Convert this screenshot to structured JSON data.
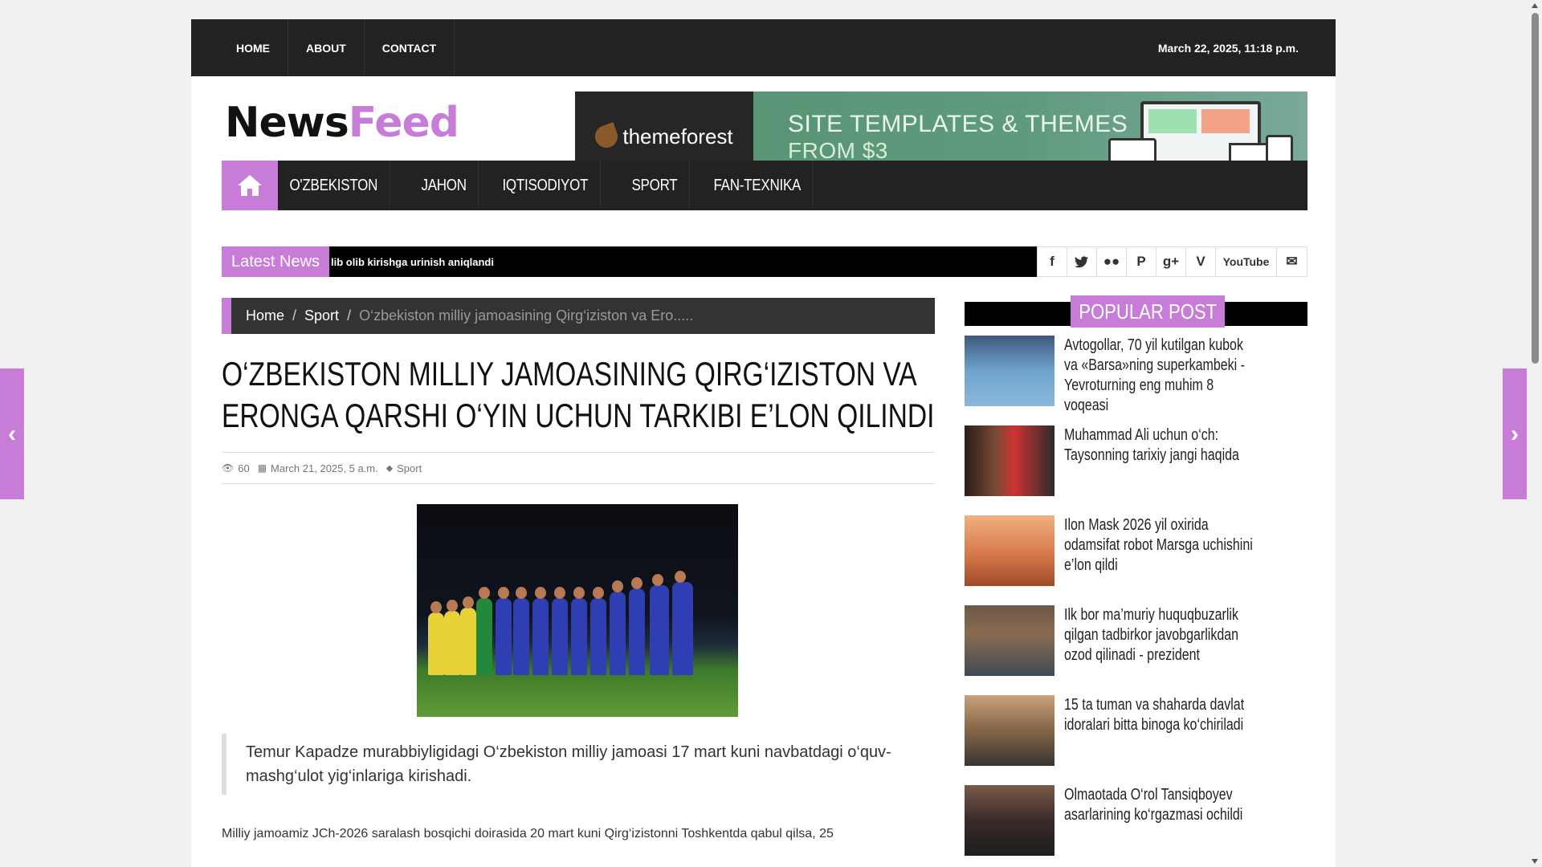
{
  "topbar": {
    "nav": [
      "HOME",
      "ABOUT",
      "CONTACT"
    ],
    "datetime": "March 22, 2025, 11:18 p.m."
  },
  "logo": {
    "part1": "News",
    "part2": "Feed"
  },
  "banner": {
    "brand": "themeforest",
    "line1": "SITE TEMPLATES & THEMES",
    "line2": "FROM $3"
  },
  "mainnav": {
    "home_icon": "home-icon",
    "items": [
      "O'ZBEKISTON",
      "JAHON",
      "IQTISODIYOT",
      "SPORT",
      "FAN-TEXNIKA"
    ]
  },
  "ticker": {
    "label": "Latest News",
    "text": "lib olib kirishga urinish aniqlandi"
  },
  "social": {
    "icons": [
      "facebook-icon",
      "twitter-icon",
      "flickr-icon",
      "pinterest-icon",
      "google-plus-icon",
      "vimeo-icon",
      "youtube-icon",
      "mail-icon"
    ],
    "youtube_text": "YouTube"
  },
  "breadcrumb": {
    "home": "Home",
    "section": "Sport",
    "current": "O‘zbekiston milliy jamoasining Qirg‘iziston va Ero....."
  },
  "article": {
    "title": "O‘ZBEKISTON MILLIY JAMOASINING QIRG‘IZISTON VA ERONGA QARSHI O‘YIN UCHUN TARKIBI E’LON QILINDI",
    "views": "60",
    "date": "March 21, 2025, 5 a.m.",
    "category": "Sport",
    "quote": "Temur Kapadze murabbiyligidagi O‘zbekiston milliy jamoasi 17 mart kuni navbatdagi o‘quv-mashg‘ulot yig‘inlariga kirishadi.",
    "paragraph": "Milliy jamoamiz JCh-2026 saralash bosqichi doirasida 20 mart kuni Qirg‘izistonni Toshkentda qabul qilsa, 25"
  },
  "sidebar": {
    "heading": "POPULAR POST",
    "posts": [
      {
        "title": "Avtogollar, 70 yil kutilgan kubok va «Barsa»ning superkambeki - Yevroturning eng muhim 8 voqeasi"
      },
      {
        "title": "Muhammad Ali uchun o‘ch: Taysonning tarixiy jangi haqida"
      },
      {
        "title": "Ilon Mask 2026 yil oxirida odamsifat robot Marsga uchishini e’lon qildi"
      },
      {
        "title": "Ilk bor ma’muriy huquqbuzarlik qilgan tadbirkor javobgarlikdan ozod qilinadi - prezident"
      },
      {
        "title": "15 ta tuman va shaharda davlat idoralari bitta binoga ko‘chiriladi"
      },
      {
        "title": "Olmaotada O‘rol Tansiqboyev asarlarining ko‘rgazmasi ochildi"
      }
    ]
  },
  "colors": {
    "accent": "#c77dd7",
    "dark": "#222222"
  }
}
